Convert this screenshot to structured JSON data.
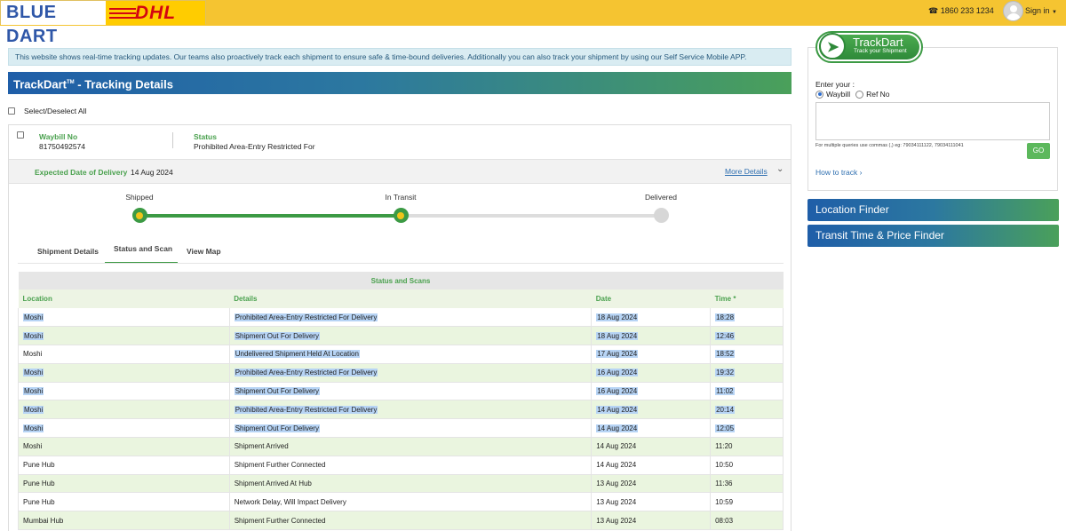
{
  "header": {
    "logo_bluedart": "BLUE DART",
    "logo_dhl": "DHL",
    "phone": "1860 233 1234",
    "signin": "Sign in"
  },
  "info_banner": "This website shows real-time tracking updates. Our teams also proactively track each shipment to ensure safe & time-bound deliveries. Additionally you can also track your shipment by using our Self Service Mobile APP.",
  "title": {
    "main": "TrackDart",
    "tm": "TM",
    "rest": " - Tracking Details"
  },
  "select_all": "Select/Deselect All",
  "shipment": {
    "waybill_label": "Waybill No",
    "waybill_value": "81750492574",
    "status_label": "Status",
    "status_value": "Prohibited Area-Entry Restricted For",
    "expected_label": "Expected Date of Delivery",
    "expected_value": "14 Aug 2024",
    "more_details": "More Details"
  },
  "progress": {
    "steps": [
      "Shipped",
      "In Transit",
      "Delivered"
    ],
    "completed": 2
  },
  "tabs": [
    "Shipment Details",
    "Status and Scan",
    "View Map"
  ],
  "active_tab": 1,
  "scans": {
    "caption": "Status and Scans",
    "headers": [
      "Location",
      "Details",
      "Date",
      "Time *"
    ],
    "rows": [
      {
        "location": "Moshi",
        "details": "Prohibited Area-Entry Restricted For Delivery",
        "date": "18 Aug 2024",
        "time": "18:28"
      },
      {
        "location": "Moshi",
        "details": "Shipment Out For Delivery",
        "date": "18 Aug 2024",
        "time": "12:46"
      },
      {
        "location": "Moshi",
        "details": "Undelivered Shipment Held At Location",
        "date": "17 Aug 2024",
        "time": "18:52"
      },
      {
        "location": "Moshi",
        "details": "Prohibited Area-Entry Restricted For Delivery",
        "date": "16 Aug 2024",
        "time": "19:32"
      },
      {
        "location": "Moshi",
        "details": "Shipment Out For Delivery",
        "date": "16 Aug 2024",
        "time": "11:02"
      },
      {
        "location": "Moshi",
        "details": "Prohibited Area-Entry Restricted For Delivery",
        "date": "14 Aug 2024",
        "time": "20:14"
      },
      {
        "location": "Moshi",
        "details": "Shipment Out For Delivery",
        "date": "14 Aug 2024",
        "time": "12:05"
      },
      {
        "location": "Moshi",
        "details": "Shipment Arrived",
        "date": "14 Aug 2024",
        "time": "11:20"
      },
      {
        "location": "Pune Hub",
        "details": "Shipment Further Connected",
        "date": "14 Aug 2024",
        "time": "10:50"
      },
      {
        "location": "Pune Hub",
        "details": "Shipment Arrived At Hub",
        "date": "13 Aug 2024",
        "time": "11:36"
      },
      {
        "location": "Pune Hub",
        "details": "Network Delay, Will Impact Delivery",
        "date": "13 Aug 2024",
        "time": "10:59"
      },
      {
        "location": "Mumbai Hub",
        "details": "Shipment Further Connected",
        "date": "13 Aug 2024",
        "time": "08:03"
      }
    ],
    "highlighted_rows": [
      0,
      1,
      3,
      4,
      5,
      6
    ]
  },
  "sidebar": {
    "logo_title": "TrackDart",
    "logo_sub": "Track your Shipment",
    "enter_label": "Enter your :",
    "radio_waybill": "Waybill",
    "radio_ref": "Ref No",
    "hint": "For multiple queries use commas (,) eg: 79034111122, 79034111041",
    "go": "GO",
    "how_to_track": "How to track",
    "location_finder": "Location Finder",
    "transit_finder": "Transit Time & Price Finder"
  },
  "colors": {
    "header_yellow": "#f5c431",
    "brand_green": "#4aa14e",
    "brand_blue": "#1f5ea8",
    "link_blue": "#2f6fb0",
    "selection_highlight": "#b7d4f5"
  },
  "icons": [
    "phone-icon",
    "avatar-icon",
    "chevron-down-icon",
    "chevron-right-icon",
    "trackdart-arrow-icon"
  ]
}
